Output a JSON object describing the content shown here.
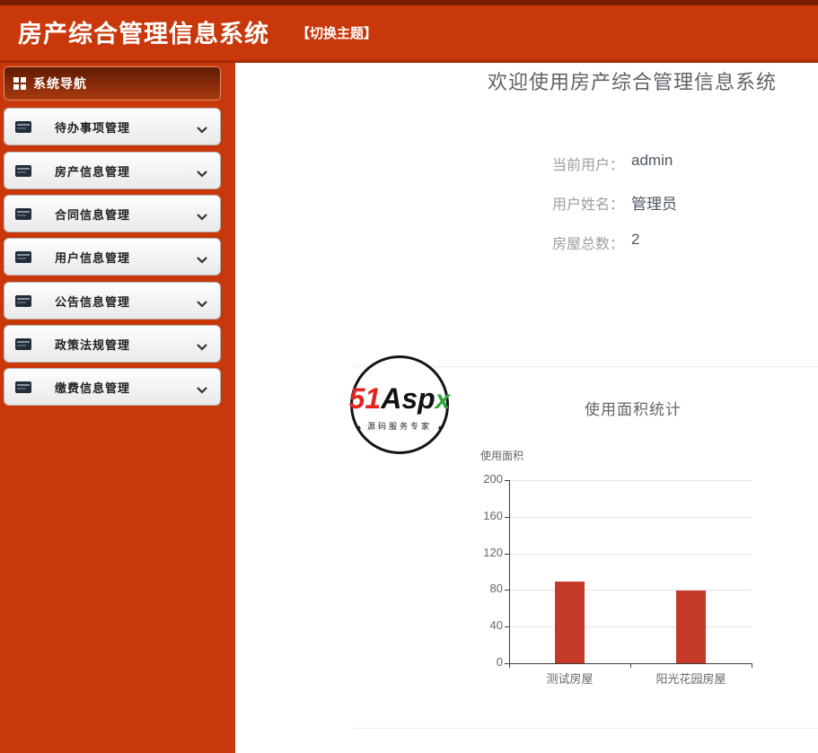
{
  "header": {
    "title": "房产综合管理信息系统",
    "theme_switch": "【切换主题】"
  },
  "sidebar": {
    "nav_title": "系统导航",
    "items": [
      {
        "label": "待办事项管理"
      },
      {
        "label": "房产信息管理"
      },
      {
        "label": "合同信息管理"
      },
      {
        "label": "用户信息管理"
      },
      {
        "label": "公告信息管理"
      },
      {
        "label": "政策法规管理"
      },
      {
        "label": "缴费信息管理"
      }
    ]
  },
  "main": {
    "welcome_title": "欢迎使用房产综合管理信息系统",
    "user_info": [
      {
        "label": "当前用户：",
        "value": "admin"
      },
      {
        "label": "用户姓名：",
        "value": "管理员"
      },
      {
        "label": "房屋总数：",
        "value": "2"
      }
    ]
  },
  "watermark": {
    "part_51": "51",
    "part_asp": "Asp",
    "part_x": "x",
    "subtitle": "源码服务专家"
  },
  "chart_data": {
    "type": "bar",
    "title": "使用面积统计",
    "ylabel": "使用面积",
    "categories": [
      "测试房屋",
      "阳光花园房屋"
    ],
    "values": [
      89,
      79
    ],
    "ylim": [
      0,
      200
    ],
    "ytick_step": 40,
    "grid": true,
    "legend": "none",
    "bar_color": "#c43a28"
  },
  "colors": {
    "header_red": "#c8380a",
    "header_top_strip": "#7a1e03",
    "nav_band_dark": "#5f1a04",
    "bar_red": "#c43a28",
    "value_text": "#4b5863",
    "label_text": "#9b9ea1"
  }
}
